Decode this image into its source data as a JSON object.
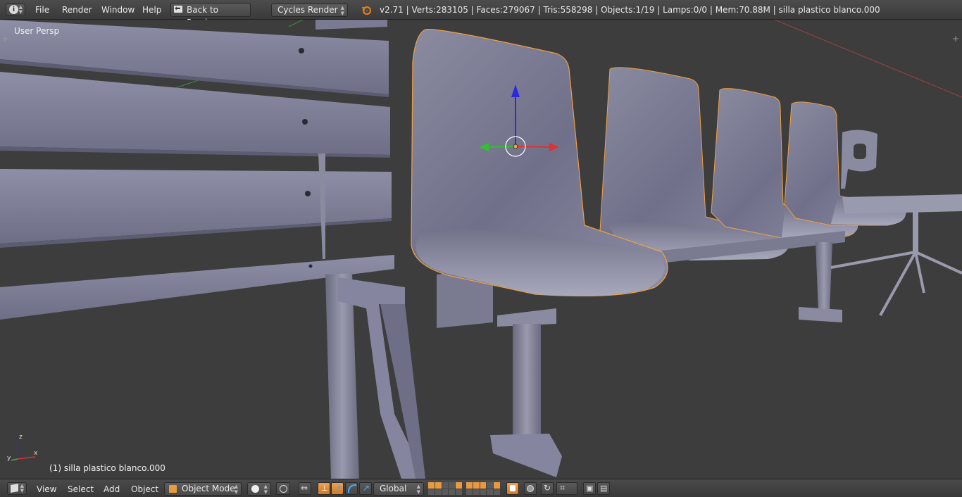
{
  "menu": {
    "file": "File",
    "render": "Render",
    "window": "Window",
    "help": "Help",
    "back": "Back to Previous"
  },
  "engine": "Cycles Render",
  "stats": "v2.71 | Verts:283105 | Faces:279067 | Tris:558298 | Objects:1/19 | Lamps:0/0 | Mem:70.88M | silla plastico blanco.000",
  "viewport": {
    "view_label": "User Persp",
    "active_object": "(1) silla plastico blanco.000",
    "axis_x": "x",
    "axis_y": "y",
    "axis_z": "z"
  },
  "bottom": {
    "view": "View",
    "select": "Select",
    "add": "Add",
    "object": "Object",
    "mode": "Object Mode",
    "orientation": "Global"
  },
  "colors": {
    "selection_outline": "#f0a040",
    "accent": "#e87d0d",
    "axis_x": "#e03030",
    "axis_y": "#30c030",
    "axis_z": "#2a2ae0"
  }
}
